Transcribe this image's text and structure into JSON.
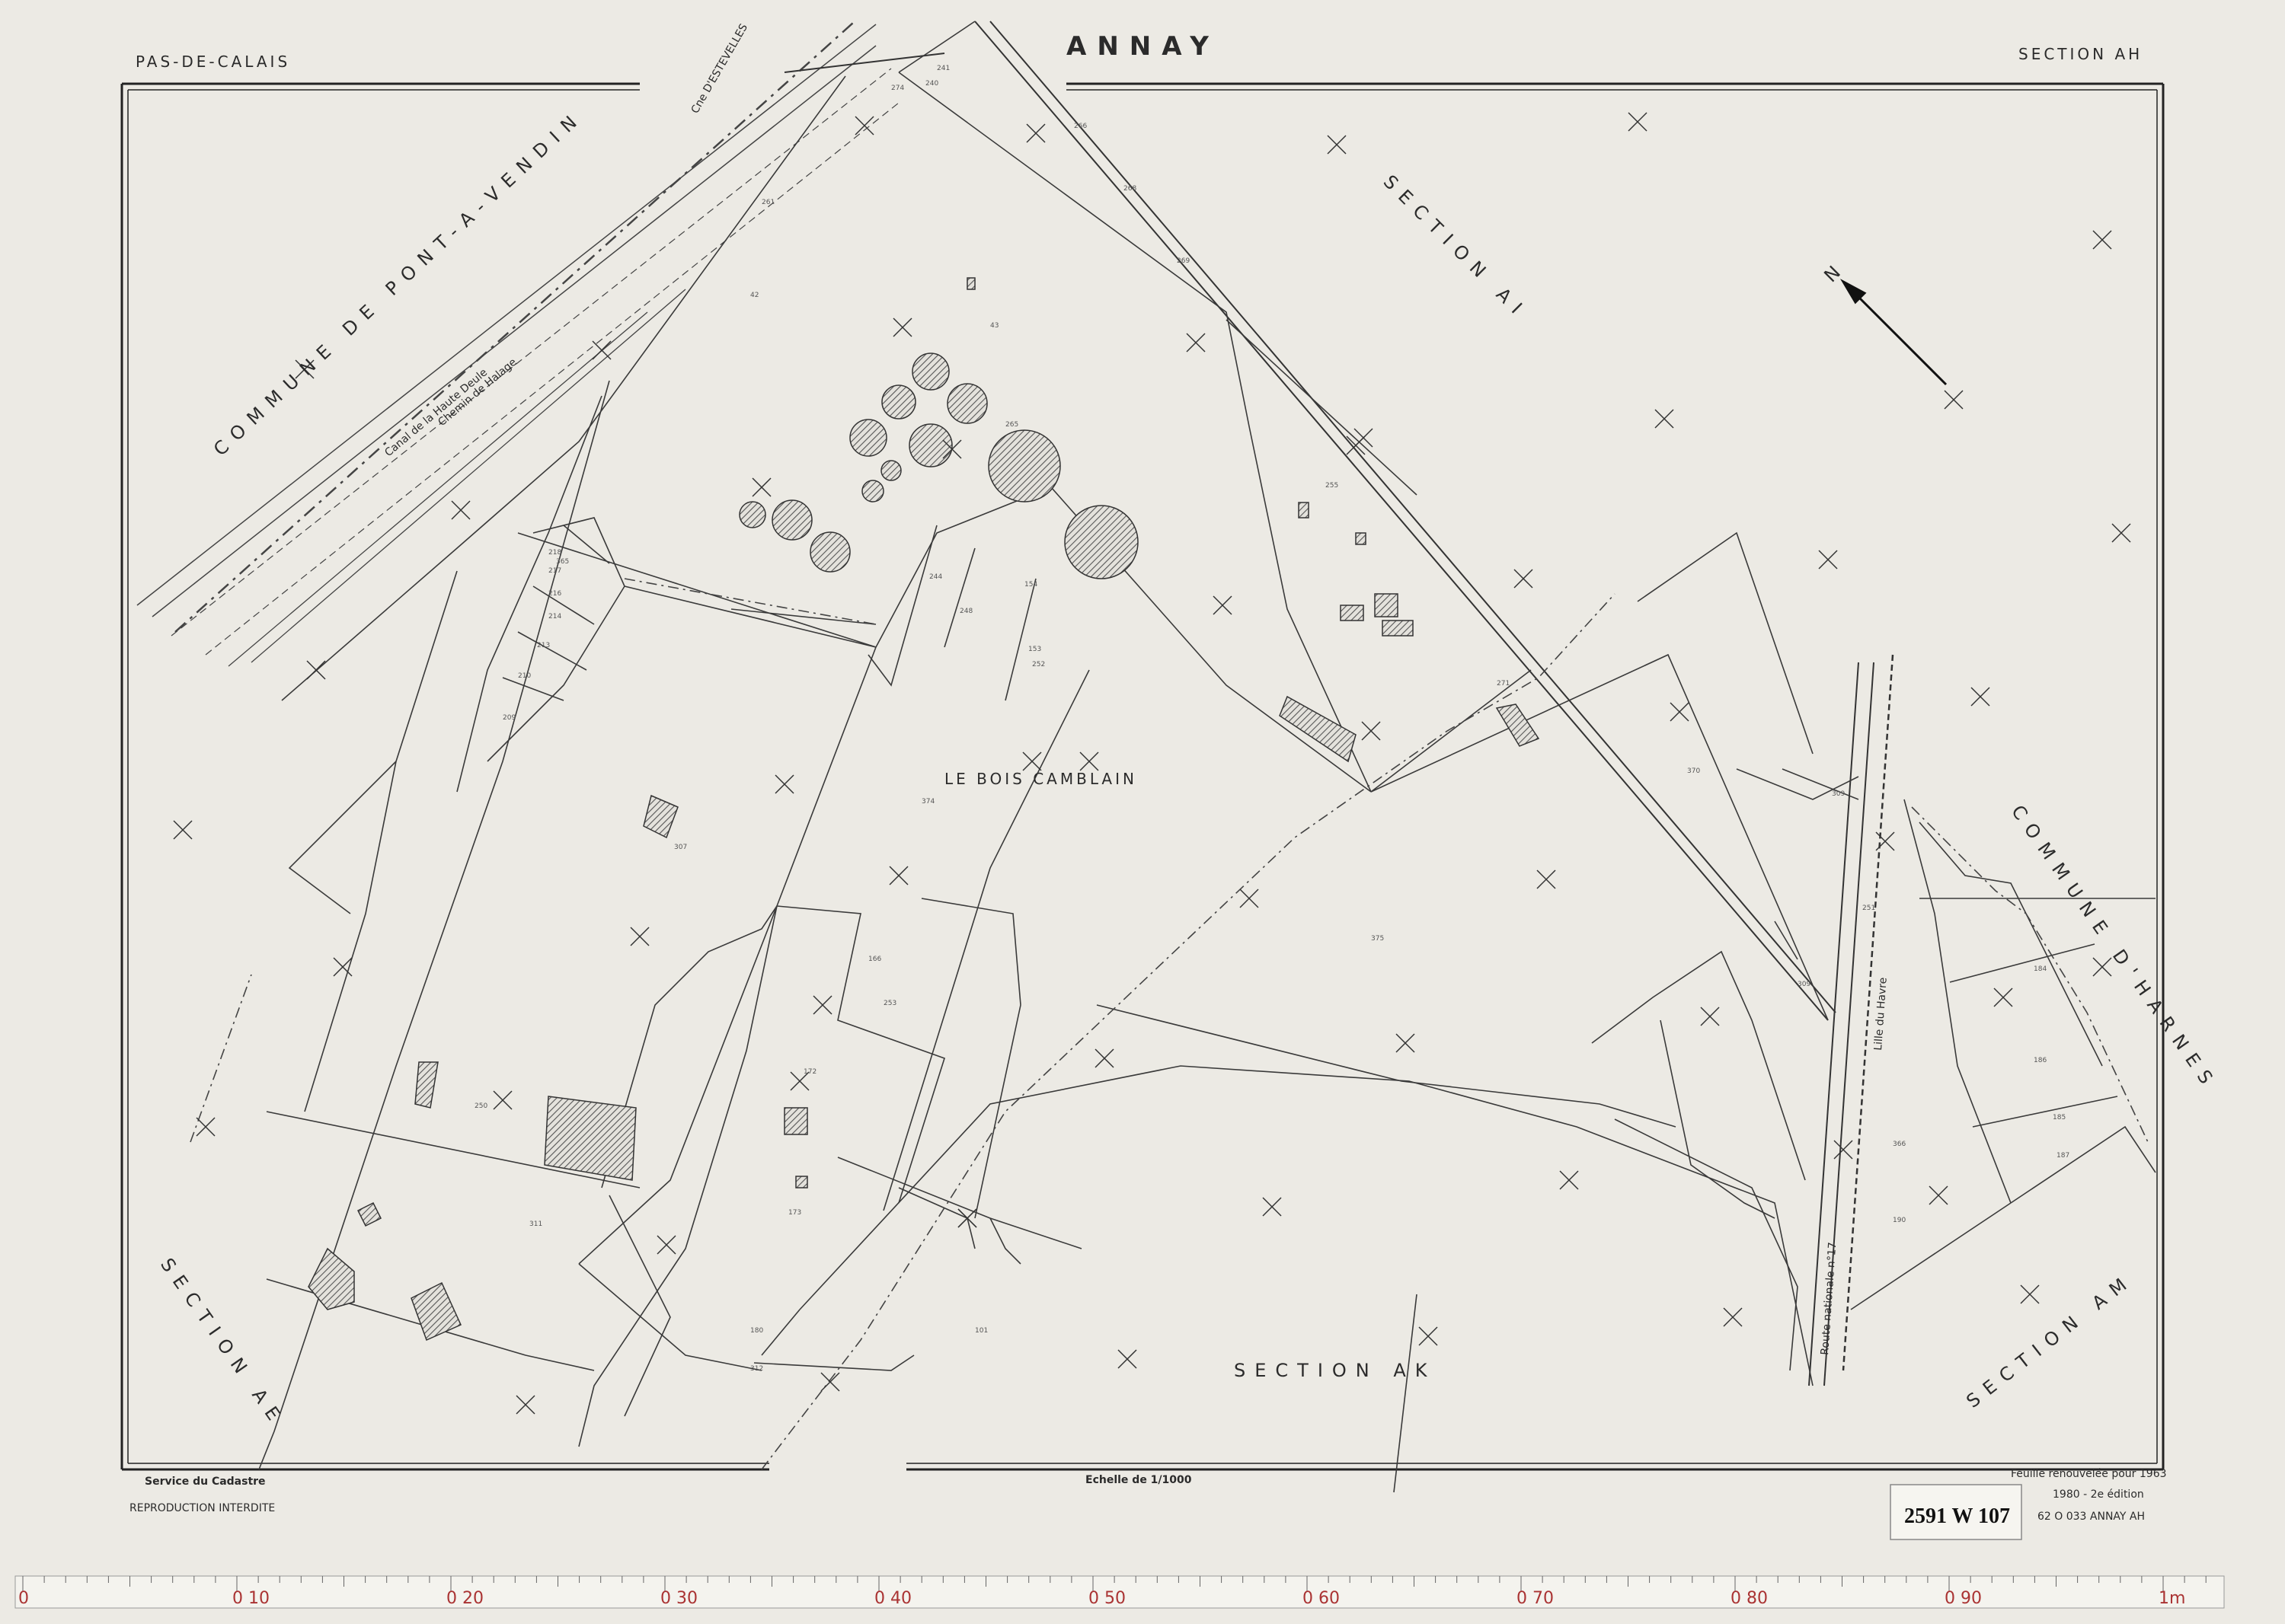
{
  "header": {
    "department": "PAS-DE-CALAIS",
    "commune": "ANNAY",
    "section": "SECTION AH"
  },
  "map_labels": {
    "pont_a_vendin": "COMMUNE DE PONT-A-VENDIN",
    "section_ai": "SECTION AI",
    "bois_camblain": "LE BOIS CAMBLAIN",
    "harnes": "COMMUNE D'HARNES",
    "section_ae": "SECTION AE",
    "section_ak": "SECTION AK",
    "section_am": "SECTION AM",
    "estevelles": "Cne D'ESTEVELLES",
    "canal": "Canal de la Haute Deule",
    "halage": "Chemin de Halage",
    "route_nationale": "Route nationale n°17",
    "route_direction": "Lille du Havre",
    "north_arrow": "N"
  },
  "parcel_numbers": [
    "274",
    "261",
    "241",
    "240",
    "266",
    "268",
    "365",
    "269",
    "42",
    "43",
    "265",
    "255",
    "218",
    "217",
    "216",
    "214",
    "213",
    "210",
    "209",
    "307",
    "374",
    "154",
    "248",
    "244",
    "153",
    "252",
    "271",
    "375",
    "370",
    "309",
    "251",
    "184",
    "186",
    "366",
    "185",
    "187",
    "190",
    "172",
    "173",
    "309",
    "253",
    "166",
    "180",
    "312",
    "311",
    "250",
    "101"
  ],
  "footer": {
    "service": "Service du Cadastre",
    "reproduction": "REPRODUCTION INTERDITE",
    "scale": "Echelle de 1/1000",
    "renewed": "Feuille renouvelée pour 1963",
    "edition": "1980 - 2e édition",
    "reference": "62 O 033 ANNAY AH",
    "archive_stamp": "2591 W 107"
  },
  "ruler": {
    "major_labels": [
      "0",
      "0 10",
      "0 20",
      "0 30",
      "0 40",
      "0 50",
      "0 60",
      "0 70",
      "0 80",
      "0 90",
      "1m"
    ],
    "unit": "cm"
  },
  "colors": {
    "paper": "#eceae4",
    "ink": "#2b2b2b",
    "hatch": "#555555",
    "ruler_red": "#aa3333"
  }
}
